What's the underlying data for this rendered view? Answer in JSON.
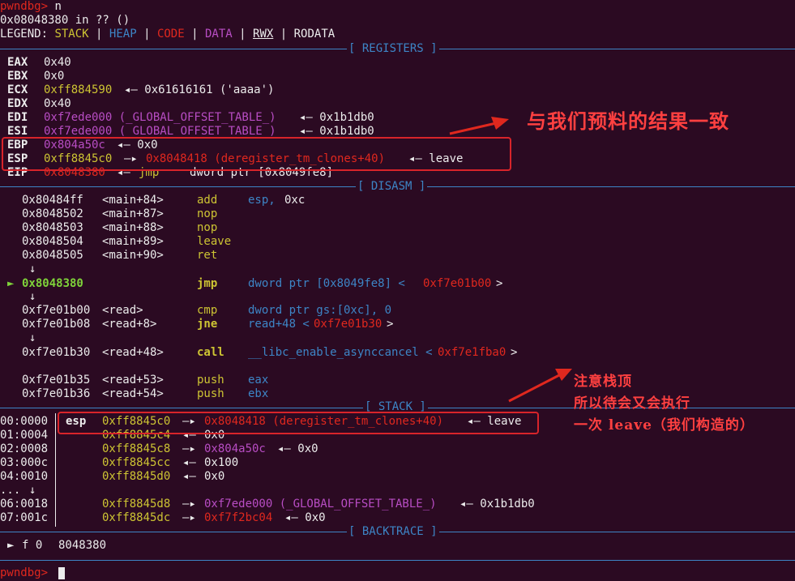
{
  "prompt": {
    "name": "pwndbg>",
    "cmd": "n"
  },
  "location": "0x08048380 in ?? ()",
  "legend": {
    "label": "LEGEND:",
    "stack": "STACK",
    "heap": "HEAP",
    "code": "CODE",
    "data": "DATA",
    "rwx": "RWX",
    "rodata": "RODATA",
    "sep": "|"
  },
  "sections": {
    "registers": "[ REGISTERS ]",
    "disasm": "[ DISASM ]",
    "stack": "[ STACK ]",
    "backtrace": "[ BACKTRACE ]"
  },
  "registers": [
    {
      "name": "EAX",
      "value": "0x40",
      "rest": ""
    },
    {
      "name": "EBX",
      "value": "0x0",
      "rest": ""
    },
    {
      "name": "ECX",
      "value": "0xff884590",
      "rest": "◂— 0x61616161 ('aaaa')"
    },
    {
      "name": "EDX",
      "value": "0x40",
      "rest": ""
    },
    {
      "name": "EDI",
      "value": "0xf7ede000 (_GLOBAL_OFFSET_TABLE_)",
      "rest": "◂— 0x1b1db0"
    },
    {
      "name": "ESI",
      "value": "0xf7ede000 (_GLOBAL_OFFSET_TABLE_)",
      "rest": "◂— 0x1b1db0"
    },
    {
      "name": "EBP",
      "value": "0x804a50c",
      "rest": "◂— 0x0"
    },
    {
      "name": "ESP",
      "value": "0xff8845c0",
      "arrow": "—▸",
      "target": "0x8048418 (deregister_tm_clones+40)",
      "rest": "◂— leave"
    },
    {
      "name": "EIP",
      "value": "0x8048380",
      "arrow": "◂—",
      "mnem": "jmp",
      "rest": "dword ptr [0x8049fe8]"
    }
  ],
  "disasm": [
    {
      "addr": "0x80484ff",
      "sym": "<main+84>",
      "mnem": "add",
      "op1": "esp,",
      "op2": "0xc",
      "op3": ""
    },
    {
      "addr": "0x8048502",
      "sym": "<main+87>",
      "mnem": "nop",
      "op1": "",
      "op2": "",
      "op3": ""
    },
    {
      "addr": "0x8048503",
      "sym": "<main+88>",
      "mnem": "nop",
      "op1": "",
      "op2": "",
      "op3": ""
    },
    {
      "addr": "0x8048504",
      "sym": "<main+89>",
      "mnem": "leave",
      "op1": "",
      "op2": "",
      "op3": ""
    },
    {
      "addr": "0x8048505",
      "sym": "<main+90>",
      "mnem": "ret",
      "op1": "",
      "op2": "",
      "op3": ""
    },
    {
      "addr": "0x8048380",
      "sym": "",
      "mnem": "jmp",
      "op1": "dword ptr [0x8049fe8] <",
      "op2": "0xf7e01b00",
      "op3": ">"
    },
    {
      "addr": "0xf7e01b00",
      "sym": "<read>",
      "mnem": "cmp",
      "op1": "dword ptr gs:[0xc], 0",
      "op2": "",
      "op3": ""
    },
    {
      "addr": "0xf7e01b08",
      "sym": "<read+8>",
      "mnem": "jne",
      "op1": "read+48 <",
      "op2": "0xf7e01b30",
      "op3": ">"
    },
    {
      "addr": "0xf7e01b30",
      "sym": "<read+48>",
      "mnem": "call",
      "op1": "__libc_enable_asynccancel <",
      "op2": "0xf7e1fba0",
      "op3": ">"
    },
    {
      "addr": "0xf7e01b35",
      "sym": "<read+53>",
      "mnem": "push",
      "op1": "eax",
      "op2": "",
      "op3": ""
    },
    {
      "addr": "0xf7e01b36",
      "sym": "<read+54>",
      "mnem": "push",
      "op1": "ebx",
      "op2": "",
      "op3": ""
    }
  ],
  "down_arrow": "↓",
  "cur_marker": "►",
  "stack": [
    {
      "idx": "00:0000",
      "reg": "esp",
      "addr": "0xff8845c0",
      "arrow": "—▸",
      "target": "0x8048418 (deregister_tm_clones+40)",
      "rest": "◂— leave"
    },
    {
      "idx": "01:0004",
      "reg": "",
      "addr": "0xff8845c4",
      "arrow": "◂—",
      "target": "",
      "rest": "0x0"
    },
    {
      "idx": "02:0008",
      "reg": "",
      "addr": "0xff8845c8",
      "arrow": "—▸",
      "target": "0x804a50c",
      "rest": "◂— 0x0"
    },
    {
      "idx": "03:000c",
      "reg": "",
      "addr": "0xff8845cc",
      "arrow": "◂—",
      "target": "",
      "rest": "0x100"
    },
    {
      "idx": "04:0010",
      "reg": "",
      "addr": "0xff8845d0",
      "arrow": "◂—",
      "target": "",
      "rest": "0x0"
    },
    {
      "idx": "...",
      "reg": "",
      "addr": "",
      "arrow": "↓",
      "target": "",
      "rest": ""
    },
    {
      "idx": "06:0018",
      "reg": "",
      "addr": "0xff8845d8",
      "arrow": "—▸",
      "target": "0xf7ede000 (_GLOBAL_OFFSET_TABLE_)",
      "rest": "◂— 0x1b1db0"
    },
    {
      "idx": "07:001c",
      "reg": "",
      "addr": "0xff8845dc",
      "arrow": "—▸",
      "target": "0xf7f2bc04",
      "rest": "◂— 0x0"
    }
  ],
  "backtrace": {
    "marker": "►",
    "frame": "f 0",
    "addr": "8048380"
  },
  "annotations": {
    "note1": "与我们预料的结果一致",
    "note2_l1": "注意栈顶",
    "note2_l2": "所以待会又会执行",
    "note2_l3": "一次 leave（我们构造的）"
  },
  "colors": {
    "bg": "#2b0a22",
    "red": "#e0281e",
    "yellow": "#cdc433",
    "blue": "#3d85c6",
    "magenta": "#b84dc4",
    "annotation": "#ff4040"
  }
}
